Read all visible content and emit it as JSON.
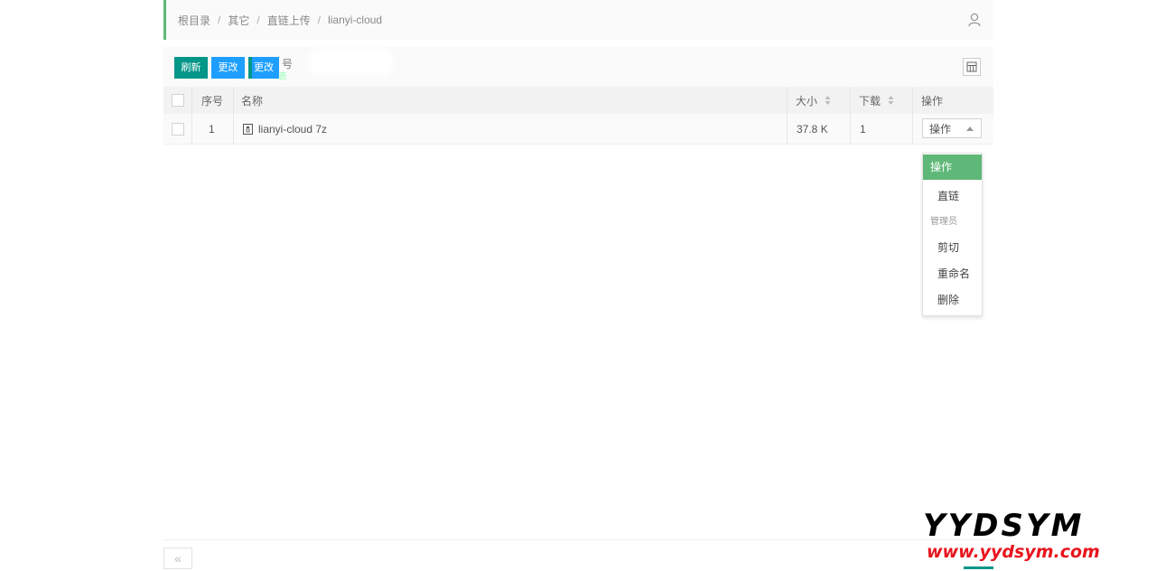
{
  "breadcrumb": [
    "根目录",
    "其它",
    "直链上传",
    "lianyi-cloud"
  ],
  "toolbar": {
    "refresh_label": "刷新",
    "change_label": "更改",
    "change2_label": "更改",
    "ghost_text": "号",
    "ghost_text2": "表"
  },
  "table": {
    "headers": {
      "index": "序号",
      "name": "名称",
      "size": "大小",
      "downloads": "下载",
      "actions": "操作"
    },
    "rows": [
      {
        "index": "1",
        "name": "lianyi-cloud 7z",
        "size": "37.8 K",
        "downloads": "1",
        "action": "操作"
      }
    ]
  },
  "dropdown": {
    "active": "操作",
    "link": "直链",
    "group": "管理员",
    "cut": "剪切",
    "rename": "重命名",
    "delete": "删除"
  },
  "pager": {
    "prev": "«"
  },
  "watermark": {
    "brand": "YYDSYM",
    "url": "www.yydsym.com"
  },
  "colors": {
    "accent": "#009688",
    "blue": "#1e9fff",
    "active_green": "#5fb878"
  }
}
